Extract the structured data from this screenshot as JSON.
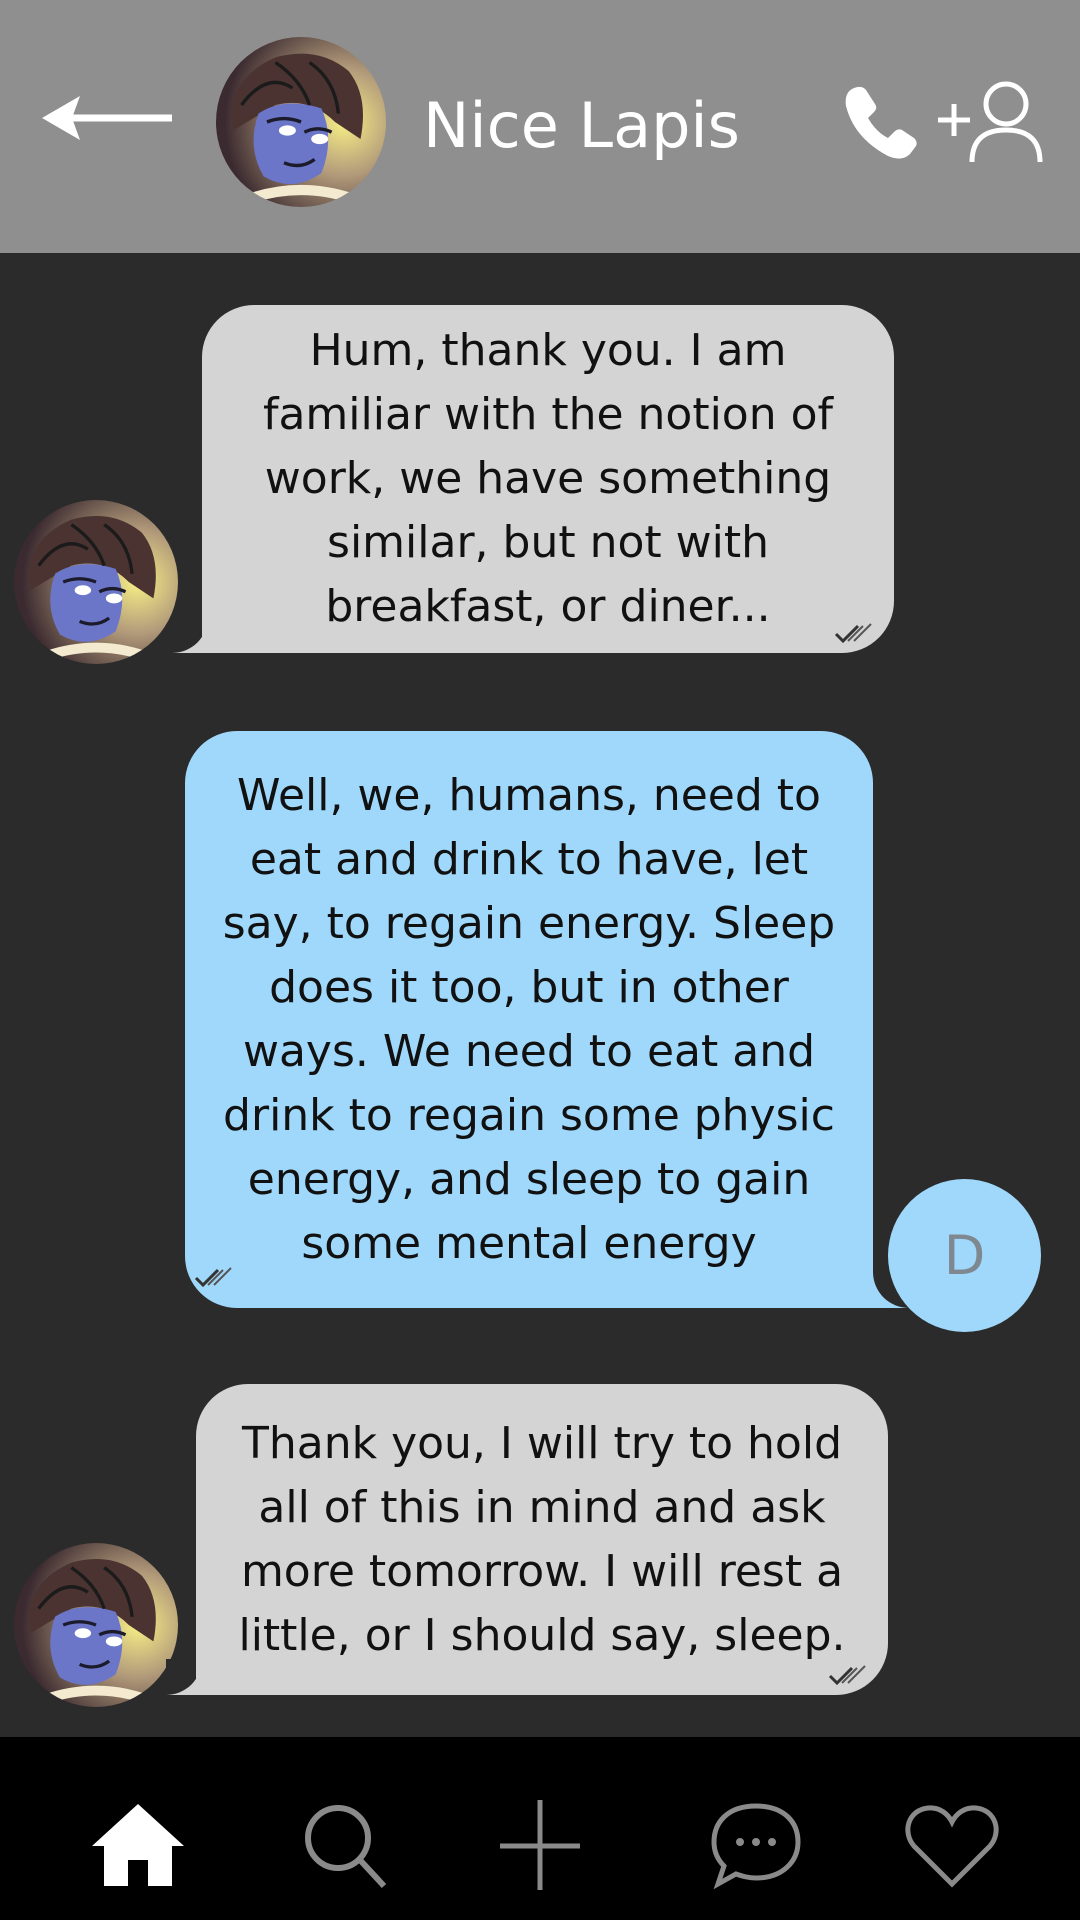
{
  "header": {
    "contact_name": "Nice Lapis",
    "back_icon": "arrow-left-icon",
    "call_icon": "phone-icon",
    "add_contact_icon": "add-user-icon"
  },
  "messages": [
    {
      "direction": "incoming",
      "text": "Hum, thank you. I am familiar with the notion of work, we have something similar, but not with breakfast, or diner...",
      "status_icon": "double-check-icon"
    },
    {
      "direction": "outgoing",
      "text": "Well, we, humans, need to eat and drink to have, let say, to regain energy. Sleep does it too, but in other ways. We need to eat and drink to regain some physic energy, and sleep to gain some mental energy",
      "status_icon": "double-check-icon"
    },
    {
      "direction": "incoming",
      "text": "Thank you, I will try to hold all of this in mind and ask more tomorrow. I will rest a little, or I should say, sleep.",
      "status_icon": "double-check-icon"
    }
  ],
  "user_avatar": {
    "initial": "D"
  },
  "bottom_nav": [
    {
      "icon": "home-icon",
      "active": true
    },
    {
      "icon": "search-icon",
      "active": false
    },
    {
      "icon": "plus-icon",
      "active": false
    },
    {
      "icon": "chat-bubble-icon",
      "active": false
    },
    {
      "icon": "heart-icon",
      "active": false
    }
  ],
  "colors": {
    "header_bg": "#8f8f8f",
    "chat_bg": "#2b2b2b",
    "incoming_bubble": "#d4d4d4",
    "outgoing_bubble": "#9fd8fa",
    "nav_bg": "#000000"
  }
}
